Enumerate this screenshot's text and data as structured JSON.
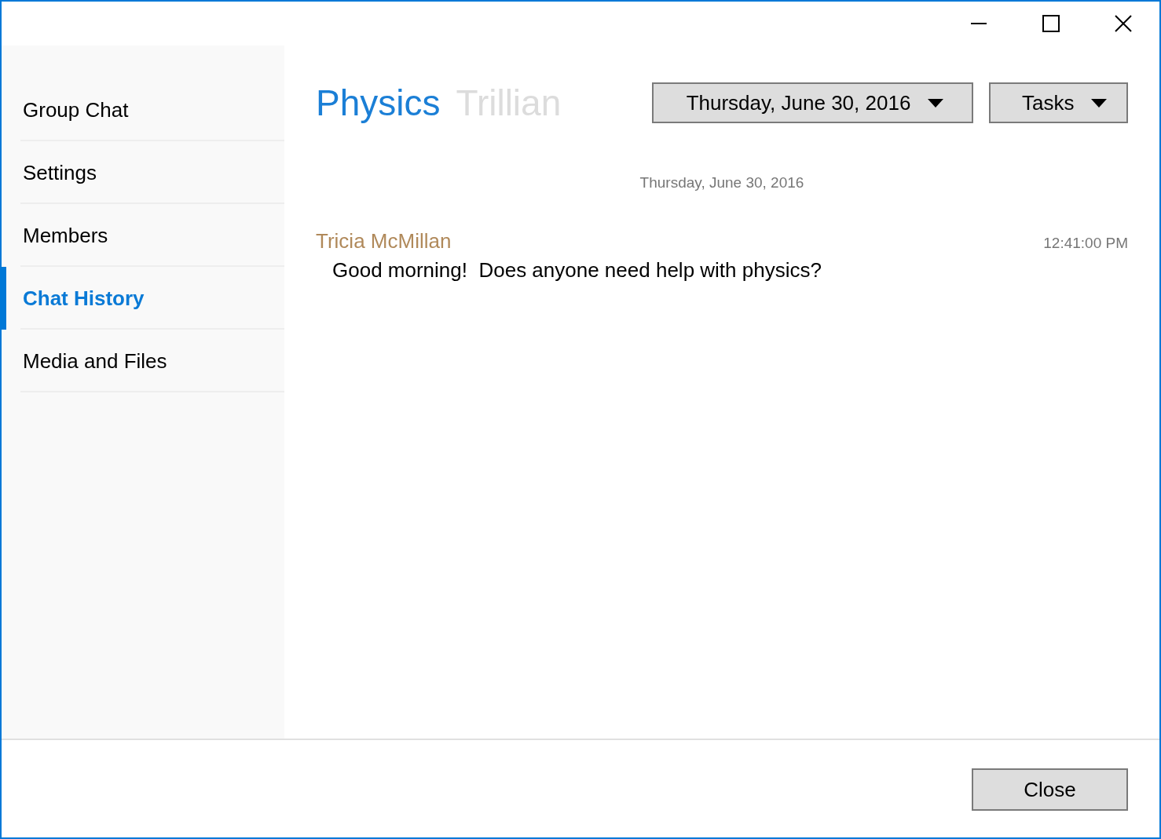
{
  "sidebar": {
    "items": [
      {
        "label": "Group Chat",
        "selected": false
      },
      {
        "label": "Settings",
        "selected": false
      },
      {
        "label": "Members",
        "selected": false
      },
      {
        "label": "Chat History",
        "selected": true
      },
      {
        "label": "Media and Files",
        "selected": false
      }
    ]
  },
  "header": {
    "title": "Physics",
    "subtitle": "Trillian",
    "dropdowns": [
      {
        "label": "Thursday, June 30, 2016"
      },
      {
        "label": "Tasks"
      }
    ]
  },
  "chat": {
    "date_separator": "Thursday, June 30, 2016",
    "messages": [
      {
        "sender": "Tricia McMillan",
        "time": "12:41:00 PM",
        "text": "Good morning!  Does anyone need help with physics?"
      }
    ]
  },
  "footer": {
    "buttons": [
      "Close"
    ]
  }
}
